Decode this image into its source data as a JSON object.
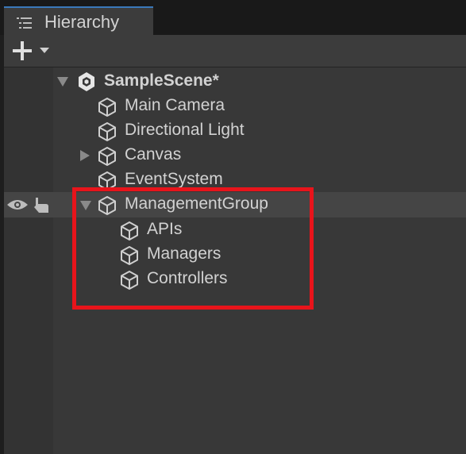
{
  "tab": {
    "title": "Hierarchy",
    "icon": "list-icon"
  },
  "toolbar": {
    "add_icon": "plus-icon",
    "dropdown_icon": "caret-down-icon"
  },
  "scene": {
    "name": "SampleScene*",
    "icon": "unity-scene-icon",
    "expanded": true
  },
  "items": [
    {
      "label": "Main Camera",
      "icon": "cube-icon"
    },
    {
      "label": "Directional Light",
      "icon": "cube-icon"
    },
    {
      "label": "Canvas",
      "icon": "cube-icon",
      "has_children": true,
      "expanded": false
    },
    {
      "label": "EventSystem",
      "icon": "cube-icon"
    },
    {
      "label": "ManagementGroup",
      "icon": "cube-icon",
      "has_children": true,
      "expanded": true,
      "hovered": true,
      "children": [
        {
          "label": "APIs",
          "icon": "cube-icon"
        },
        {
          "label": "Managers",
          "icon": "cube-icon"
        },
        {
          "label": "Controllers",
          "icon": "cube-icon"
        }
      ]
    }
  ],
  "row_icons": {
    "visibility": "eye-icon",
    "pickability": "hand-icon"
  },
  "annotation": {
    "color": "#e8141b",
    "shape": "rectangle"
  },
  "colors": {
    "background": "#383838",
    "tab_active": "#3c3c3c",
    "tab_accent": "#3a79bb",
    "text": "#d2d2d2",
    "hover_row": "#454545"
  }
}
